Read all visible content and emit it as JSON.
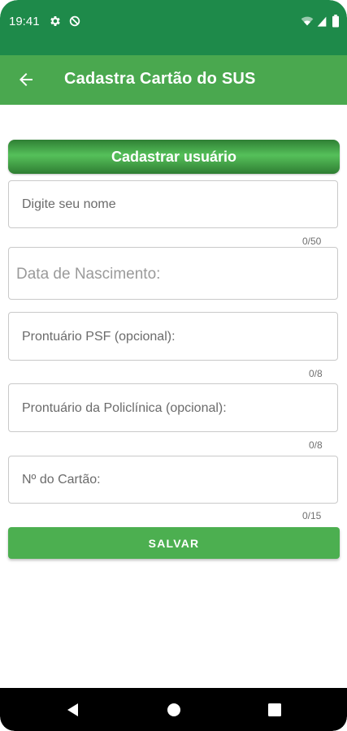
{
  "status_bar": {
    "time": "19:41",
    "icons": [
      "settings-icon",
      "sync-off-icon",
      "wifi-icon",
      "signal-icon",
      "battery-icon"
    ]
  },
  "app_bar": {
    "title": "Cadastra Cartão do SUS",
    "back_icon": "arrow-back-icon"
  },
  "form": {
    "header": "Cadastrar usuário",
    "fields": [
      {
        "placeholder": "Digite seu nome",
        "counter": "0/50"
      },
      {
        "placeholder": "Data de Nascimento:",
        "counter": ""
      },
      {
        "placeholder": "Prontuário PSF (opcional):",
        "counter": "0/8"
      },
      {
        "placeholder": "Prontuário da Policlínica (opcional):",
        "counter": "0/8"
      },
      {
        "placeholder": "Nº do Cartão:",
        "counter": "0/15"
      }
    ],
    "save_label": "SALVAR"
  },
  "nav_bar": {
    "icons": [
      "nav-back-icon",
      "nav-home-icon",
      "nav-recents-icon"
    ]
  },
  "colors": {
    "status_bar": "#1e8a4a",
    "app_bar": "#4aa84f",
    "accent": "#4caf50"
  }
}
